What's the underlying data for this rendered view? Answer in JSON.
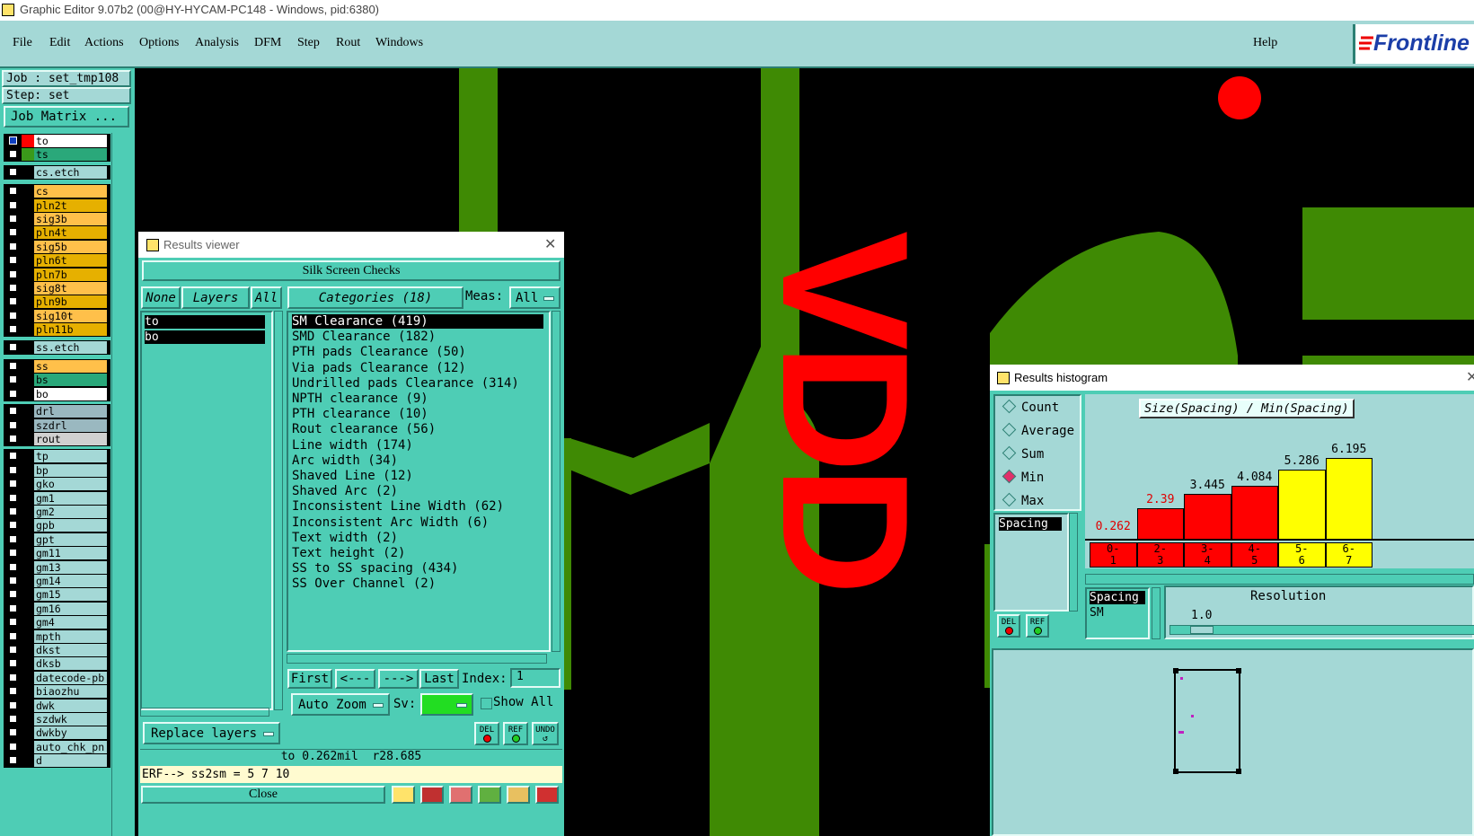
{
  "window": {
    "title": "Graphic Editor 9.07b2 (00@HY-HYCAM-PC148 - Windows, pid:6380)"
  },
  "menu": {
    "items": [
      "File",
      "Edit",
      "Actions",
      "Options",
      "Analysis",
      "DFM",
      "Step",
      "Rout",
      "Windows"
    ],
    "help": "Help",
    "logo": "Frontline"
  },
  "job": {
    "job_label": "Job : set_tmp108",
    "step_label": "Step: set",
    "matrix_button": "Job Matrix ..."
  },
  "layers": [
    {
      "name": "to",
      "color": "#ffffff",
      "swatch": "#ff0000",
      "selected": true
    },
    {
      "name": "ts",
      "color": "#2aa87a",
      "swatch": "#3a9a1a"
    },
    {
      "name": "cs.etch",
      "color": "#a4d8d6",
      "group": true
    },
    {
      "name": "cs",
      "color": "#ffc04a"
    },
    {
      "name": "pln2t",
      "color": "#e6b000"
    },
    {
      "name": "sig3b",
      "color": "#ffc04a"
    },
    {
      "name": "pln4t",
      "color": "#e6b000"
    },
    {
      "name": "sig5b",
      "color": "#ffc04a"
    },
    {
      "name": "pln6t",
      "color": "#e6b000"
    },
    {
      "name": "pln7b",
      "color": "#e6b000"
    },
    {
      "name": "sig8t",
      "color": "#ffc04a"
    },
    {
      "name": "pln9b",
      "color": "#e6b000"
    },
    {
      "name": "sig10t",
      "color": "#ffc04a"
    },
    {
      "name": "pln11b",
      "color": "#e6b000"
    },
    {
      "name": "ss.etch",
      "color": "#a4d8d6",
      "group": true
    },
    {
      "name": "ss",
      "color": "#ffc04a"
    },
    {
      "name": "bs",
      "color": "#2aa87a"
    },
    {
      "name": "bo",
      "color": "#ffffff"
    },
    {
      "name": "drl",
      "color": "#9ab8c0"
    },
    {
      "name": "szdrl",
      "color": "#9ab8c0"
    },
    {
      "name": "rout",
      "color": "#d0d0d0"
    },
    {
      "name": "tp",
      "color": "#a4d8d6"
    },
    {
      "name": "bp",
      "color": "#a4d8d6"
    },
    {
      "name": "gko",
      "color": "#a4d8d6"
    },
    {
      "name": "gm1",
      "color": "#a4d8d6"
    },
    {
      "name": "gm2",
      "color": "#a4d8d6"
    },
    {
      "name": "gpb",
      "color": "#a4d8d6"
    },
    {
      "name": "gpt",
      "color": "#a4d8d6"
    },
    {
      "name": "gm11",
      "color": "#a4d8d6"
    },
    {
      "name": "gm13",
      "color": "#a4d8d6"
    },
    {
      "name": "gm14",
      "color": "#a4d8d6"
    },
    {
      "name": "gm15",
      "color": "#a4d8d6"
    },
    {
      "name": "gm16",
      "color": "#a4d8d6"
    },
    {
      "name": "gm4",
      "color": "#a4d8d6"
    },
    {
      "name": "mpth",
      "color": "#a4d8d6"
    },
    {
      "name": "dkst",
      "color": "#a4d8d6"
    },
    {
      "name": "dksb",
      "color": "#a4d8d6"
    },
    {
      "name": "datecode-pb",
      "color": "#a4d8d6"
    },
    {
      "name": "biaozhu",
      "color": "#a4d8d6"
    },
    {
      "name": "dwk",
      "color": "#a4d8d6"
    },
    {
      "name": "szdwk",
      "color": "#a4d8d6"
    },
    {
      "name": "dwkby",
      "color": "#a4d8d6"
    },
    {
      "name": "auto_chk_pn",
      "color": "#a4d8d6"
    },
    {
      "name": "d",
      "color": "#a4d8d6"
    }
  ],
  "canvas": {
    "text": "VDD"
  },
  "results_viewer": {
    "title": "Results viewer",
    "header": "Silk Screen Checks",
    "none_btn": "None",
    "layers_btn": "Layers",
    "all_btn": "All",
    "categories_btn": "Categories (18)",
    "meas_label": "Meas:",
    "meas_value": "All",
    "layer_list": [
      "to",
      "bo"
    ],
    "categories": [
      "SM Clearance (419)",
      "SMD Clearance (182)",
      "PTH pads Clearance (50)",
      "Via pads Clearance (12)",
      "Undrilled pads Clearance (314)",
      "NPTH clearance (9)",
      "PTH clearance (10)",
      "Rout clearance (56)",
      "Line width (174)",
      "Arc width (34)",
      "Shaved Line (12)",
      "Shaved Arc (2)",
      "Inconsistent Line Width (62)",
      "Inconsistent Arc Width (6)",
      "Text width (2)",
      "Text height (2)",
      "SS to SS spacing (434)",
      "SS Over Channel (2)"
    ],
    "first_btn": "First",
    "prev_btn": "<---",
    "next_btn": "--->",
    "last_btn": "Last",
    "index_label": "Index:",
    "index_value": "1",
    "auto_zoom": "Auto Zoom",
    "sv_label": "Sv:",
    "show_all": "Show All",
    "replace_layers": "Replace layers",
    "del": "DEL",
    "ref": "REF",
    "undo": "UNDO",
    "status": "to 0.262mil  r28.685",
    "erf": "ERF--> ss2sm = 5 7 10",
    "close": "Close"
  },
  "histogram": {
    "title": "Results histogram",
    "modes": [
      "Count",
      "Average",
      "Sum",
      "Min",
      "Max"
    ],
    "selected_mode": "Min",
    "measure_list": [
      "Spacing"
    ],
    "chart_title": "Size(Spacing) / Min(Spacing)",
    "del": "DEL",
    "ref": "REF",
    "spacing_list": [
      "Spacing",
      "SM"
    ],
    "resolution_label": "Resolution",
    "resolution_value": "1.0",
    "chart_data": {
      "type": "bar",
      "categories": [
        "0-1",
        "2-3",
        "3-4",
        "4-5",
        "5-6",
        "6-7"
      ],
      "values": [
        0.262,
        2.39,
        3.445,
        4.084,
        5.286,
        6.195
      ],
      "colors": [
        "#ff0000",
        "#ff0000",
        "#ff0000",
        "#ff0000",
        "#ffff00",
        "#ffff00"
      ],
      "title": "Size(Spacing) / Min(Spacing)"
    }
  }
}
